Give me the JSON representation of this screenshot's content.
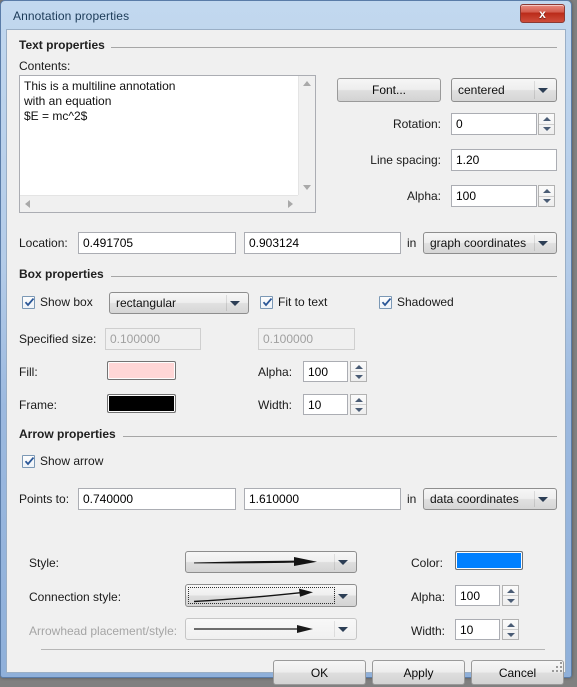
{
  "window": {
    "title": "Annotation properties",
    "close_label": "x"
  },
  "sections": {
    "text_properties": "Text properties",
    "box_properties": "Box properties",
    "arrow_properties": "Arrow properties"
  },
  "text_properties": {
    "contents_label": "Contents:",
    "contents_value": "This is a multiline annotation\nwith an equation\n$E = mc^2$",
    "font_button": "Font...",
    "alignment_value": "centered",
    "rotation_label": "Rotation:",
    "rotation_value": "0",
    "line_spacing_label": "Line spacing:",
    "line_spacing_value": "1.20",
    "alpha_label": "Alpha:",
    "alpha_value": "100",
    "location_label": "Location:",
    "location_x": "0.491705",
    "location_y": "0.903124",
    "location_in": "in",
    "location_units": "graph coordinates"
  },
  "box_properties": {
    "show_box_label": "Show box",
    "show_box_checked": true,
    "box_style_value": "rectangular",
    "fit_to_text_label": "Fit to text",
    "fit_to_text_checked": true,
    "shadowed_label": "Shadowed",
    "shadowed_checked": true,
    "specified_size_label": "Specified size:",
    "specified_size_w": "0.100000",
    "specified_size_h": "0.100000",
    "fill_label": "Fill:",
    "fill_color": "#FFD6D6",
    "fill_alpha_label": "Alpha:",
    "fill_alpha_value": "100",
    "frame_label": "Frame:",
    "frame_color": "#000000",
    "frame_width_label": "Width:",
    "frame_width_value": "10"
  },
  "arrow_properties": {
    "show_arrow_label": "Show arrow",
    "show_arrow_checked": true,
    "points_to_label": "Points to:",
    "points_to_x": "0.740000",
    "points_to_y": "1.610000",
    "points_to_in": "in",
    "points_to_units": "data coordinates",
    "style_label": "Style:",
    "connection_style_label": "Connection style:",
    "arrowhead_label": "Arrowhead placement/style:",
    "color_label": "Color:",
    "color_value": "#0080FF",
    "alpha_label": "Alpha:",
    "alpha_value": "100",
    "width_label": "Width:",
    "width_value": "10"
  },
  "footer": {
    "ok": "OK",
    "apply": "Apply",
    "cancel": "Cancel"
  }
}
